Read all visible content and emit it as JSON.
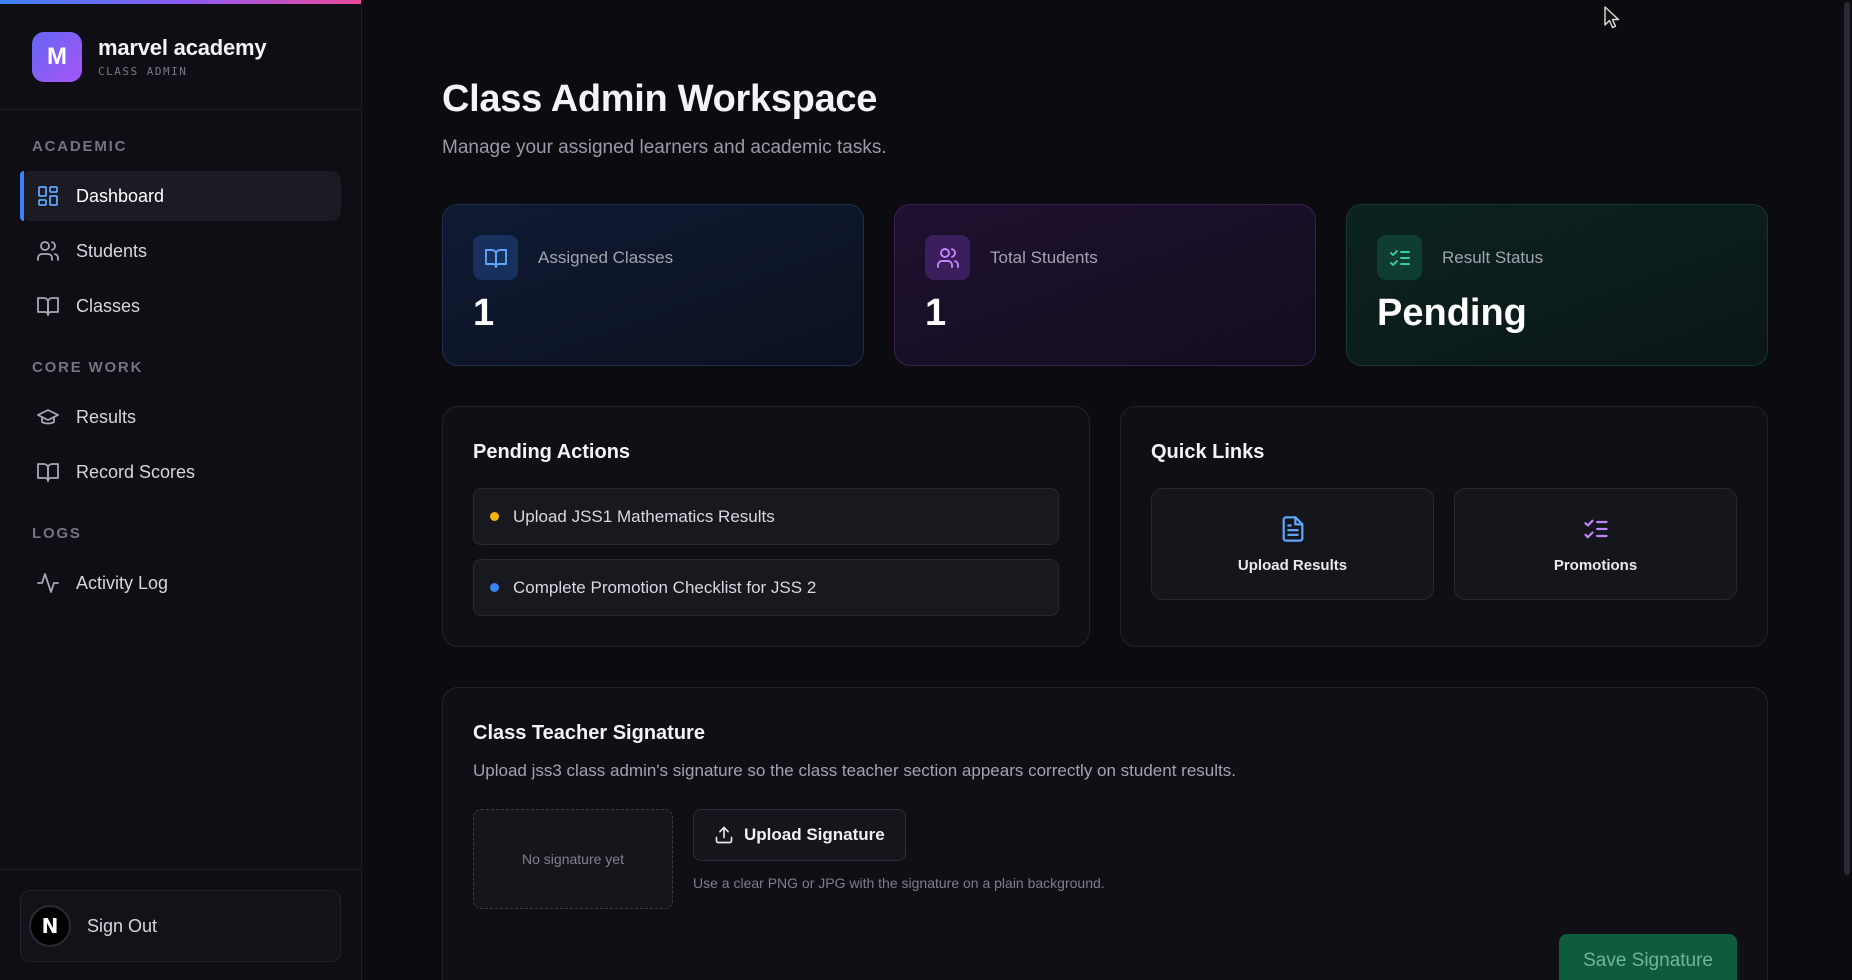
{
  "brand": {
    "logo_letter": "M",
    "name": "marvel academy",
    "role": "CLASS ADMIN",
    "gradient": [
      "#6366f1",
      "#a855f7"
    ]
  },
  "nav": {
    "sections": [
      {
        "title": "ACADEMIC",
        "items": [
          {
            "label": "Dashboard",
            "icon": "dashboard-grid-icon",
            "active": true
          },
          {
            "label": "Students",
            "icon": "users-icon"
          },
          {
            "label": "Classes",
            "icon": "book-open-icon"
          }
        ]
      },
      {
        "title": "CORE WORK",
        "items": [
          {
            "label": "Results",
            "icon": "graduation-cap-icon"
          },
          {
            "label": "Record Scores",
            "icon": "book-open-icon"
          }
        ]
      },
      {
        "title": "LOGS",
        "items": [
          {
            "label": "Activity Log",
            "icon": "activity-icon"
          }
        ]
      }
    ],
    "sign_out": {
      "label": "Sign Out",
      "avatar_letter": "N"
    }
  },
  "page": {
    "title": "Class Admin Workspace",
    "subtitle": "Manage your assigned learners and academic tasks."
  },
  "stats": [
    {
      "label": "Assigned Classes",
      "value": "1",
      "icon": "book-open-icon",
      "accent": "#60a5fa"
    },
    {
      "label": "Total Students",
      "value": "1",
      "icon": "users-icon",
      "accent": "#c084fc"
    },
    {
      "label": "Result Status",
      "value": "Pending",
      "icon": "list-checks-icon",
      "accent": "#34d399"
    }
  ],
  "pending_actions": {
    "title": "Pending Actions",
    "items": [
      {
        "label": "Upload JSS1 Mathematics Results",
        "dot_color": "#f5b40b"
      },
      {
        "label": "Complete Promotion Checklist for JSS 2",
        "dot_color": "#3b82f6"
      }
    ]
  },
  "quick_links": {
    "title": "Quick Links",
    "items": [
      {
        "label": "Upload Results",
        "icon": "file-text-icon",
        "accent": "#60a5fa"
      },
      {
        "label": "Promotions",
        "icon": "list-checks-icon",
        "accent": "#c084fc"
      }
    ]
  },
  "signature": {
    "title": "Class Teacher Signature",
    "description": "Upload jss3 class admin's signature so the class teacher section appears correctly on student results.",
    "placeholder": "No signature yet",
    "upload_label": "Upload Signature",
    "hint": "Use a clear PNG or JPG with the signature on a plain background.",
    "save_label": "Save Signature"
  }
}
